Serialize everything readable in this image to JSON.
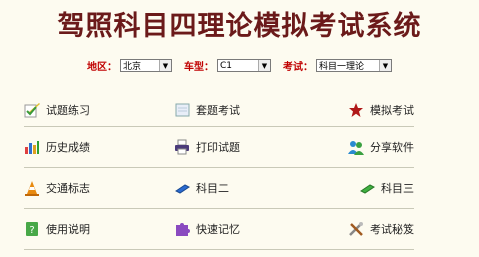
{
  "title": "驾照科目四理论模拟考试系统",
  "filters": [
    {
      "label": "地区：",
      "value": "北京"
    },
    {
      "label": "车型：",
      "value": "C1"
    },
    {
      "label": "考试：",
      "value": "科目一理论"
    }
  ],
  "menu": [
    {
      "label": "试题练习",
      "icon": "pencil-paper-icon"
    },
    {
      "label": "套题考试",
      "icon": "blank-paper-icon"
    },
    {
      "label": "模拟考试",
      "icon": "red-star-icon"
    },
    {
      "label": "历史成绩",
      "icon": "bar-chart-icon"
    },
    {
      "label": "打印试题",
      "icon": "printer-icon"
    },
    {
      "label": "分享软件",
      "icon": "users-icon"
    },
    {
      "label": "交通标志",
      "icon": "traffic-cone-icon"
    },
    {
      "label": "科目二",
      "icon": "blue-eraser-icon"
    },
    {
      "label": "科目三",
      "icon": "green-eraser-icon"
    },
    {
      "label": "使用说明",
      "icon": "help-book-icon"
    },
    {
      "label": "快速记忆",
      "icon": "puzzle-icon"
    },
    {
      "label": "考试秘笈",
      "icon": "tools-icon"
    }
  ],
  "colors": {
    "title": "#6b1a1a",
    "filter_label": "#c00000",
    "background": "#fdfbf0"
  }
}
